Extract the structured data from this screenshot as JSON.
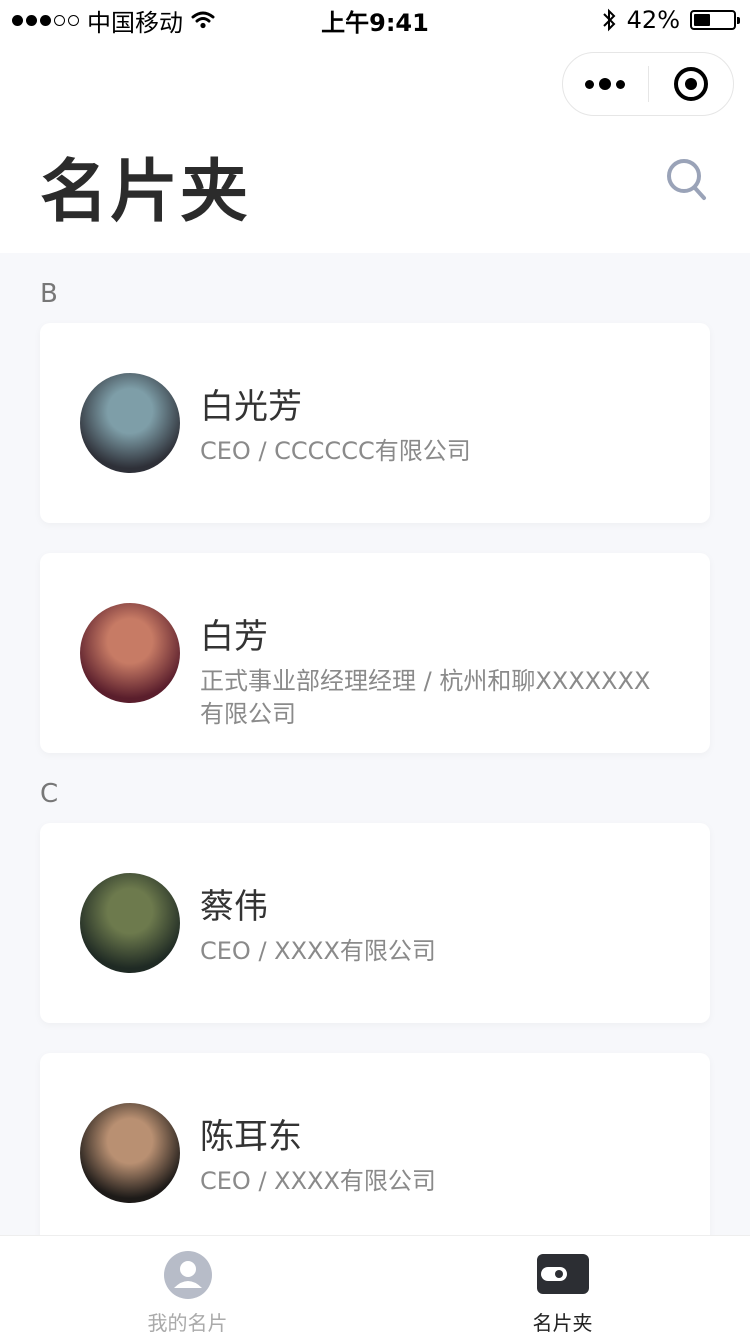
{
  "status_bar": {
    "carrier": "中国移动",
    "time": "上午9:41",
    "battery": "42%",
    "battery_level": 0.42
  },
  "header": {
    "title": "名片夹"
  },
  "sections": [
    {
      "letter": "B",
      "cards": [
        {
          "name": "白光芳",
          "subtitle": "CEO / CCCCCC有限公司",
          "avatar_colors": [
            "#7e9ea8",
            "#2e3038"
          ]
        },
        {
          "name": "白芳",
          "subtitle": "正式事业部经理经理 / 杭州和聊XXXXXXX有限公司",
          "avatar_colors": [
            "#c77b65",
            "#5a1e2c"
          ]
        }
      ]
    },
    {
      "letter": "C",
      "cards": [
        {
          "name": "蔡伟",
          "subtitle": "CEO / XXXX有限公司",
          "avatar_colors": [
            "#6d7a4d",
            "#1f2a24"
          ]
        },
        {
          "name": "陈耳东",
          "subtitle": "CEO / XXXX有限公司",
          "avatar_colors": [
            "#b99072",
            "#1d1a18"
          ]
        }
      ]
    }
  ],
  "tabbar": {
    "tabs": [
      {
        "label": "我的名片",
        "active": false
      },
      {
        "label": "名片夹",
        "active": true
      }
    ]
  }
}
